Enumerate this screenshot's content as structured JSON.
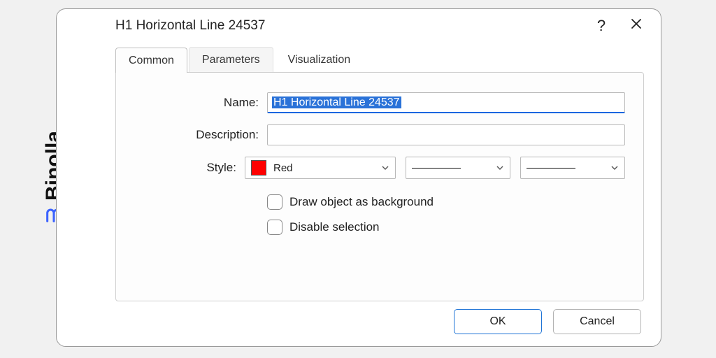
{
  "brand": {
    "name": "Binolla"
  },
  "dialog": {
    "title": "H1 Horizontal Line 24537",
    "help_tooltip": "?",
    "tabs": {
      "common": "Common",
      "parameters": "Parameters",
      "visualization": "Visualization",
      "active": "common"
    },
    "form": {
      "name_label": "Name:",
      "name_value": "H1 Horizontal Line 24537",
      "description_label": "Description:",
      "description_value": "",
      "style_label": "Style:",
      "color_name": "Red",
      "color_hex": "#ff0000",
      "draw_bg_label": "Draw object as background",
      "draw_bg_checked": false,
      "disable_sel_label": "Disable selection",
      "disable_sel_checked": false
    },
    "buttons": {
      "ok": "OK",
      "cancel": "Cancel"
    }
  }
}
